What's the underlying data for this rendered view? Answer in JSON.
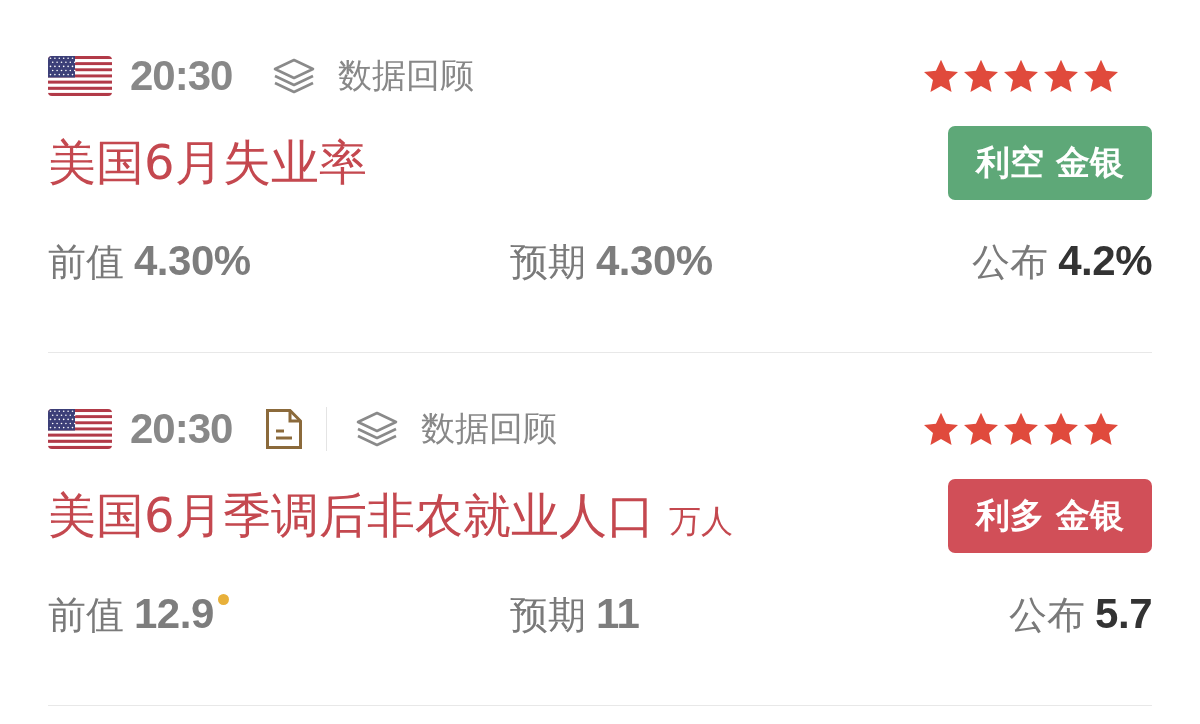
{
  "events": [
    {
      "time": "20:30",
      "document": false,
      "review": "数据回顾",
      "stars": 5,
      "title": "美国6月失业率",
      "badge": {
        "text": "利空 金银",
        "color": "#5ea878"
      },
      "values": [
        {
          "kind": "previous",
          "label": "前值",
          "value": "4.30%",
          "revised": false
        },
        {
          "kind": "forecast",
          "label": "预期",
          "value": "4.30%",
          "revised": false
        },
        {
          "kind": "actual",
          "label": "公布",
          "value": "4.2%",
          "revised": false
        }
      ]
    },
    {
      "time": "20:30",
      "document": true,
      "review": "数据回顾",
      "stars": 5,
      "title": "美国6月季调后非农就业人口",
      "unit": "万人",
      "badge": {
        "text": "利多 金银",
        "color": "#d14f58"
      },
      "values": [
        {
          "kind": "previous",
          "label": "前值",
          "value": "12.9",
          "revised": true
        },
        {
          "kind": "forecast",
          "label": "预期",
          "value": "11",
          "revised": false
        },
        {
          "kind": "actual",
          "label": "公布",
          "value": "5.7",
          "revised": false
        }
      ]
    }
  ]
}
